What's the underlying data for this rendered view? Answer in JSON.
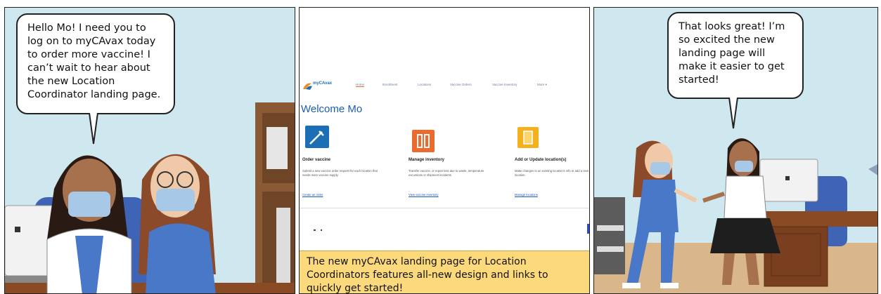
{
  "panel1": {
    "speech": "Hello Mo! I need you to log on to myCAvax today to order more vaccine! I can’t wait to hear about the new Location Coordinator landing page."
  },
  "panel2": {
    "logo_text": "myCAvax",
    "nav": [
      "Home",
      "Enrollment",
      "Locations",
      "Vaccine Orders",
      "Vaccine Inventory",
      "More ▾"
    ],
    "welcome": "Welcome Mo",
    "tiles": [
      {
        "title": "Order vaccine",
        "desc": "Submit a new vaccine order request for each location that needs more vaccine supply.",
        "link": "Create an order",
        "color": "#1c6fb5",
        "icon": "syringe-icon"
      },
      {
        "title": "Manage inventory",
        "desc": "Transfer vaccine, or report loss due to waste, temperature excursions or shipment incidents.",
        "link": "View vaccine inventory",
        "color": "#ec6a2e",
        "icon": "vials-icon"
      },
      {
        "title": "Add or Update location(s)",
        "desc": "Make changes to an existing location’s info or add a new location.",
        "link": "Manage locations",
        "color": "#f5b01e",
        "icon": "document-icon"
      }
    ],
    "caption": "The new myCAvax landing page for Location Coordinators features all-new design and links to quickly get started!"
  },
  "panel3": {
    "speech": "That looks great! I’m so excited the new landing page will make it easier to get started!"
  }
}
